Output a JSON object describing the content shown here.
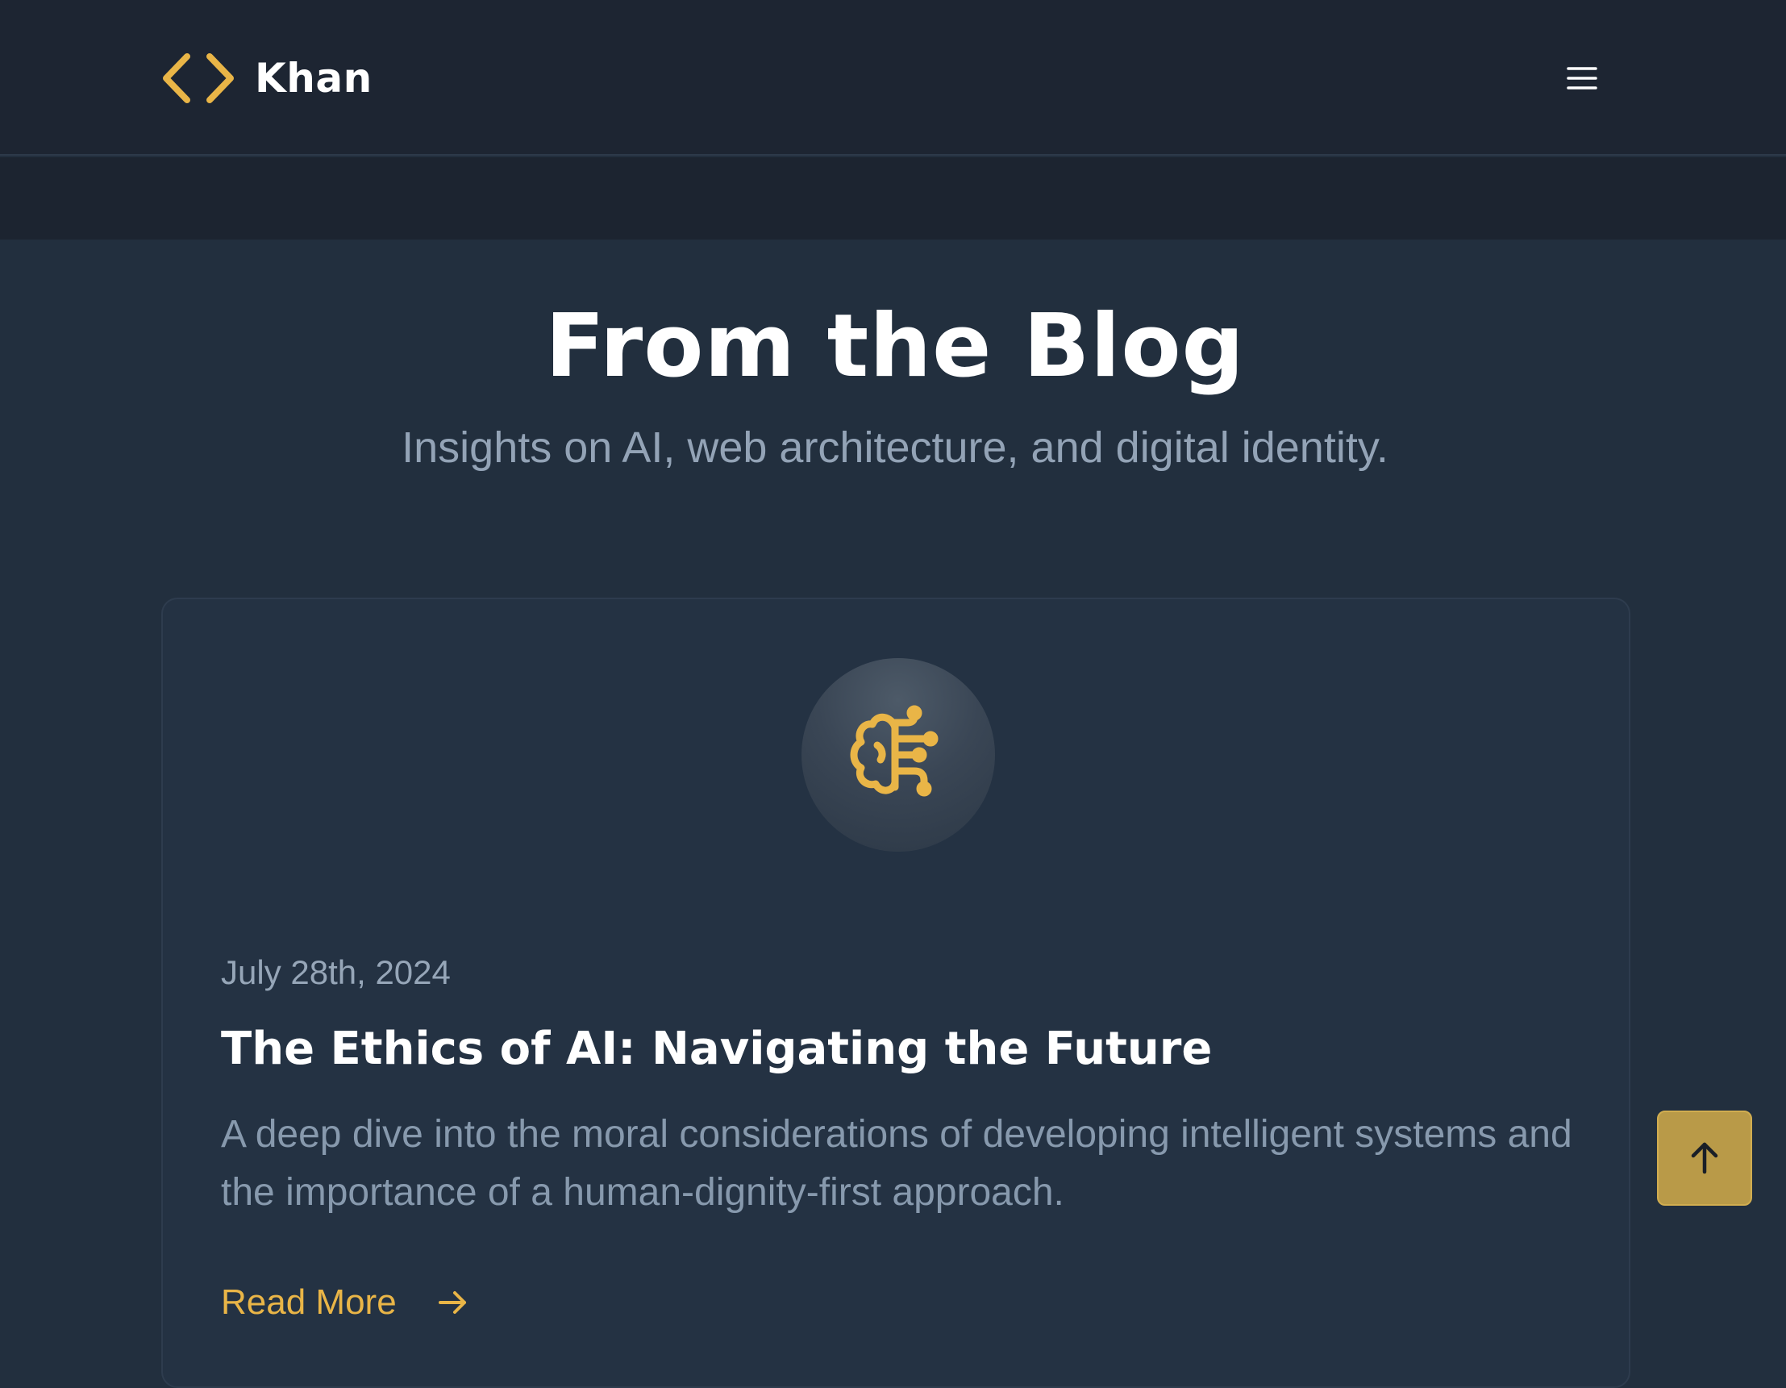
{
  "header": {
    "brand_name": "Khan",
    "brand_icon": "code-brackets-icon",
    "menu_icon": "hamburger-menu-icon"
  },
  "hero": {
    "title": "From the Blog",
    "subtitle": "Insights on AI, web architecture, and digital identity."
  },
  "posts": [
    {
      "icon": "brain-circuit-icon",
      "date": "July 28th, 2024",
      "title": "The Ethics of AI: Navigating the Future",
      "excerpt": "A deep dive into the moral considerations of developing intelligent systems and the importance of a human-dignity-first approach.",
      "read_more_label": "Read More",
      "read_more_icon": "arrow-right-icon"
    }
  ],
  "scroll_top": {
    "icon": "arrow-up-icon"
  },
  "colors": {
    "accent": "#e9b547",
    "header_bg": "#1d2532",
    "page_bg": "#222f3e",
    "card_bg": "#243243",
    "scroll_button_bg": "#b99a48"
  }
}
